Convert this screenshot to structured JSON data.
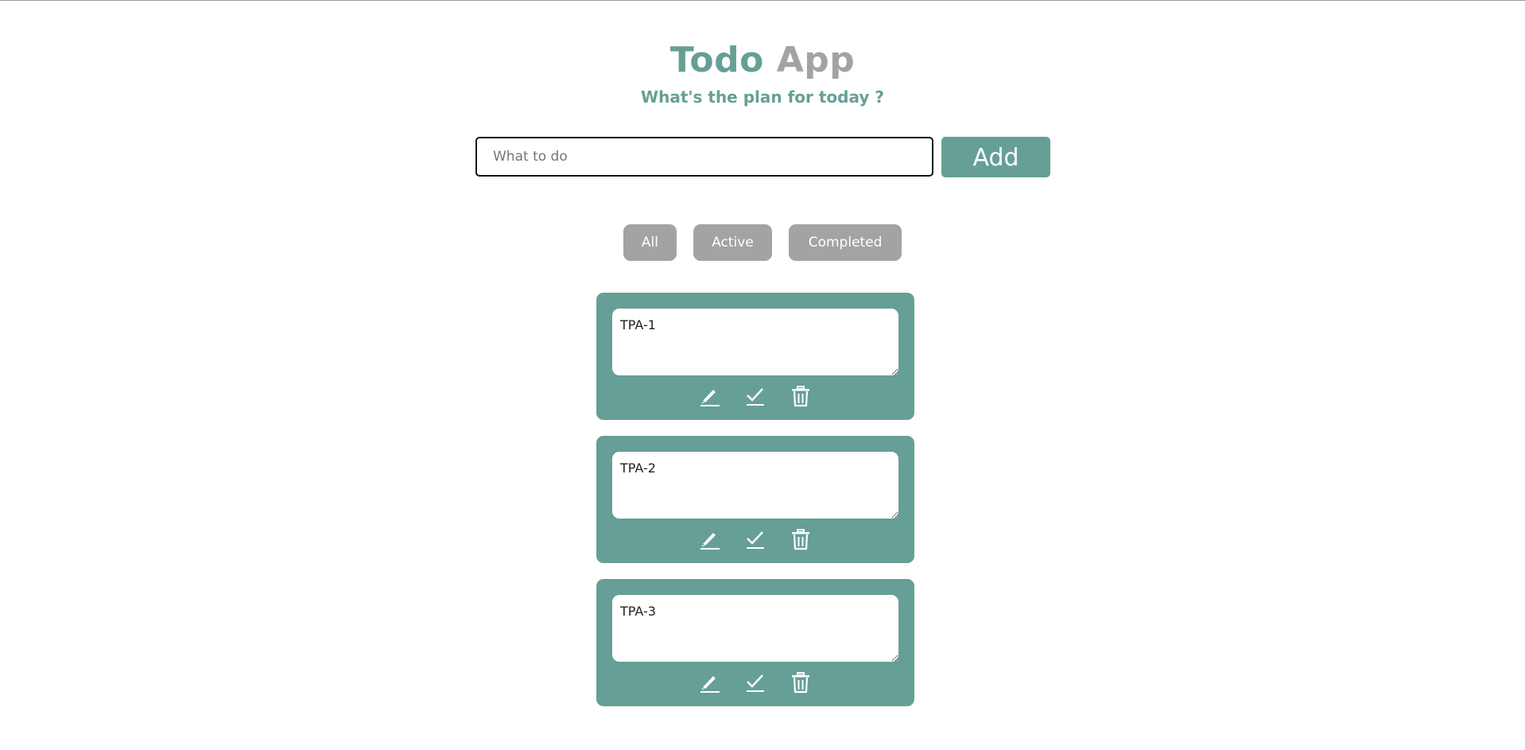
{
  "header": {
    "title_part1": "Todo",
    "title_part2": "App",
    "subtitle": "What's the plan for today ?"
  },
  "form": {
    "input_placeholder": "What to do",
    "input_value": "",
    "add_label": "Add"
  },
  "filters": {
    "all": "All",
    "active": "Active",
    "completed": "Completed"
  },
  "todos": [
    {
      "text": "TPA-1"
    },
    {
      "text": "TPA-2"
    },
    {
      "text": "TPA-3"
    }
  ],
  "icons": {
    "edit": "pencil-icon",
    "complete": "checkmark-icon",
    "delete": "trash-icon"
  },
  "colors": {
    "primary": "#669f95",
    "secondary": "#a3a3a3",
    "background": "#ffffff"
  }
}
